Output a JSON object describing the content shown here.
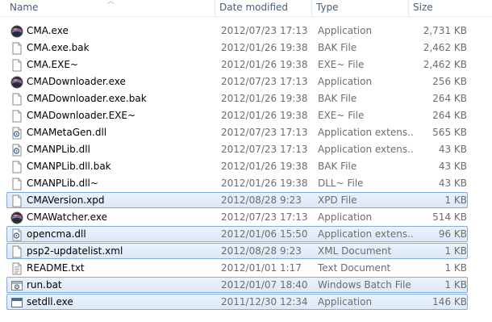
{
  "columns": {
    "name": "Name",
    "date": "Date modified",
    "type": "Type",
    "size": "Size"
  },
  "files": [
    {
      "name": "CMA.exe",
      "date": "2012/07/23 17:13",
      "type": "Application",
      "size": "2,731 KB",
      "icon": "app-globe-icon",
      "selected": false
    },
    {
      "name": "CMA.exe.bak",
      "date": "2012/01/26 19:38",
      "type": "BAK File",
      "size": "2,462 KB",
      "icon": "blank-file-icon",
      "selected": false
    },
    {
      "name": "CMA.EXE~",
      "date": "2012/01/26 19:38",
      "type": "EXE~ File",
      "size": "2,462 KB",
      "icon": "blank-file-icon",
      "selected": false
    },
    {
      "name": "CMADownloader.exe",
      "date": "2012/07/23 17:13",
      "type": "Application",
      "size": "256 KB",
      "icon": "app-globe-icon",
      "selected": false
    },
    {
      "name": "CMADownloader.exe.bak",
      "date": "2012/01/26 19:38",
      "type": "BAK File",
      "size": "264 KB",
      "icon": "blank-file-icon",
      "selected": false
    },
    {
      "name": "CMADownloader.EXE~",
      "date": "2012/01/26 19:38",
      "type": "EXE~ File",
      "size": "264 KB",
      "icon": "blank-file-icon",
      "selected": false
    },
    {
      "name": "CMAMetaGen.dll",
      "date": "2012/07/23 17:13",
      "type": "Application extens...",
      "size": "565 KB",
      "icon": "dll-gear-icon",
      "selected": false
    },
    {
      "name": "CMANPLib.dll",
      "date": "2012/07/23 17:13",
      "type": "Application extens...",
      "size": "43 KB",
      "icon": "dll-gear-icon",
      "selected": false
    },
    {
      "name": "CMANPLib.dll.bak",
      "date": "2012/01/26 19:38",
      "type": "BAK File",
      "size": "43 KB",
      "icon": "blank-file-icon",
      "selected": false
    },
    {
      "name": "CMANPLib.dll~",
      "date": "2012/01/26 19:38",
      "type": "DLL~ File",
      "size": "43 KB",
      "icon": "blank-file-icon",
      "selected": false
    },
    {
      "name": "CMAVersion.xpd",
      "date": "2012/08/28 9:23",
      "type": "XPD File",
      "size": "1 KB",
      "icon": "blank-file-icon",
      "selected": true
    },
    {
      "name": "CMAWatcher.exe",
      "date": "2012/07/23 17:13",
      "type": "Application",
      "size": "514 KB",
      "icon": "app-globe-icon",
      "selected": false
    },
    {
      "name": "opencma.dll",
      "date": "2012/01/06 15:50",
      "type": "Application extens...",
      "size": "96 KB",
      "icon": "dll-gear-icon",
      "selected": true
    },
    {
      "name": "psp2-updatelist.xml",
      "date": "2012/08/28 9:23",
      "type": "XML Document",
      "size": "1 KB",
      "icon": "blank-file-icon",
      "selected": true
    },
    {
      "name": "README.txt",
      "date": "2012/01/01 1:17",
      "type": "Text Document",
      "size": "1 KB",
      "icon": "text-file-icon",
      "selected": false
    },
    {
      "name": "run.bat",
      "date": "2012/01/07 18:40",
      "type": "Windows Batch File",
      "size": "1 KB",
      "icon": "batch-gear-icon",
      "selected": true
    },
    {
      "name": "setdll.exe",
      "date": "2011/12/30 12:34",
      "type": "Application",
      "size": "146 KB",
      "icon": "app-window-icon",
      "selected": true
    }
  ]
}
